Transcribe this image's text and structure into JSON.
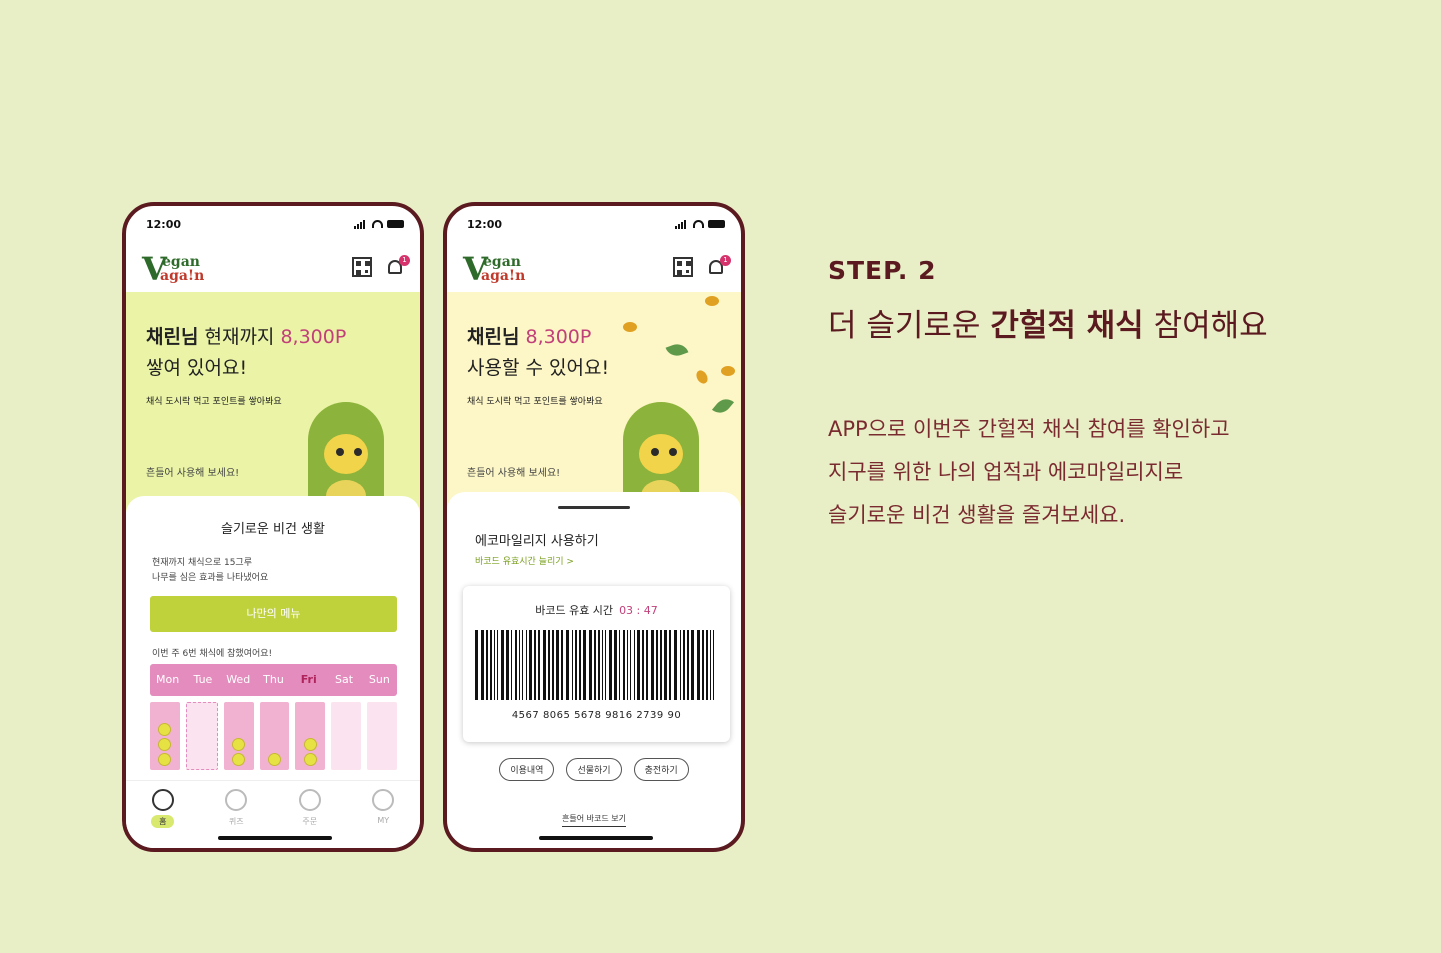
{
  "status": {
    "time": "12:00"
  },
  "logo": {
    "v": "V",
    "line1": "egan",
    "line2": "aga!n"
  },
  "notification_count": "1",
  "phone1": {
    "hero": {
      "name": "채린님",
      "text1": " 현재까지 ",
      "points": "8,300P",
      "text2": "쌓여 있어요!",
      "sub": "채식 도시락 먹고 포인트를 쌓아봐요",
      "shake": "흔들어 사용해 보세요!"
    },
    "sheet": {
      "title": "슬기로운 비건 생활",
      "desc1": "현재까지 채식으로 15그루",
      "desc2": "나무를 심은 효과를 나타냈어요",
      "menu_button": "나만의 메뉴",
      "week_note": "이번 주 6번 채식에 참했여어요!",
      "days": [
        "Mon",
        "Tue",
        "Wed",
        "Thu",
        "Fri",
        "Sat",
        "Sun"
      ],
      "active_day": "Fri",
      "day_counts": [
        3,
        0,
        2,
        1,
        2,
        0,
        0
      ]
    },
    "tabs": [
      "홈",
      "퀴즈",
      "주문",
      "MY"
    ]
  },
  "phone2": {
    "hero": {
      "name": "채린님",
      "points": "8,300P",
      "text2": "사용할 수 있어요!",
      "sub": "채식 도시락 먹고 포인트를 쌓아봐요",
      "shake": "흔들어 사용해 보세요!"
    },
    "sheet": {
      "title": "에코마일리지 사용하기",
      "link": "바코드 유효시간 늘리기 >",
      "barcode_label": "바코드 유효 시간",
      "timer": "03 : 47",
      "barcode_number": "4567  8065  5678  9816  2739  90",
      "pills": [
        "이용내역",
        "선물하기",
        "충전하기"
      ],
      "shake_link": "흔들어 바코드 보기"
    }
  },
  "copy": {
    "step": "STEP. 2",
    "headline_a": "더 슬기로운 ",
    "headline_b": "간헐적 채식",
    "headline_c": " 참여해요",
    "body1": "APP으로 이번주 간헐적 채식 참여를 확인하고",
    "body2": "지구를 위한 나의 업적과 에코마일리지로",
    "body3": "슬기로운 비건 생활을 즐겨보세요."
  },
  "colors": {
    "frame": "#5a1a1f",
    "accent_pink": "#c2407a",
    "lime": "#bfd23c",
    "background": "#e8efc6"
  },
  "icons": [
    "qr-icon",
    "bell-icon",
    "badge-icon",
    "search-icon",
    "truck-icon",
    "phone-icon"
  ]
}
